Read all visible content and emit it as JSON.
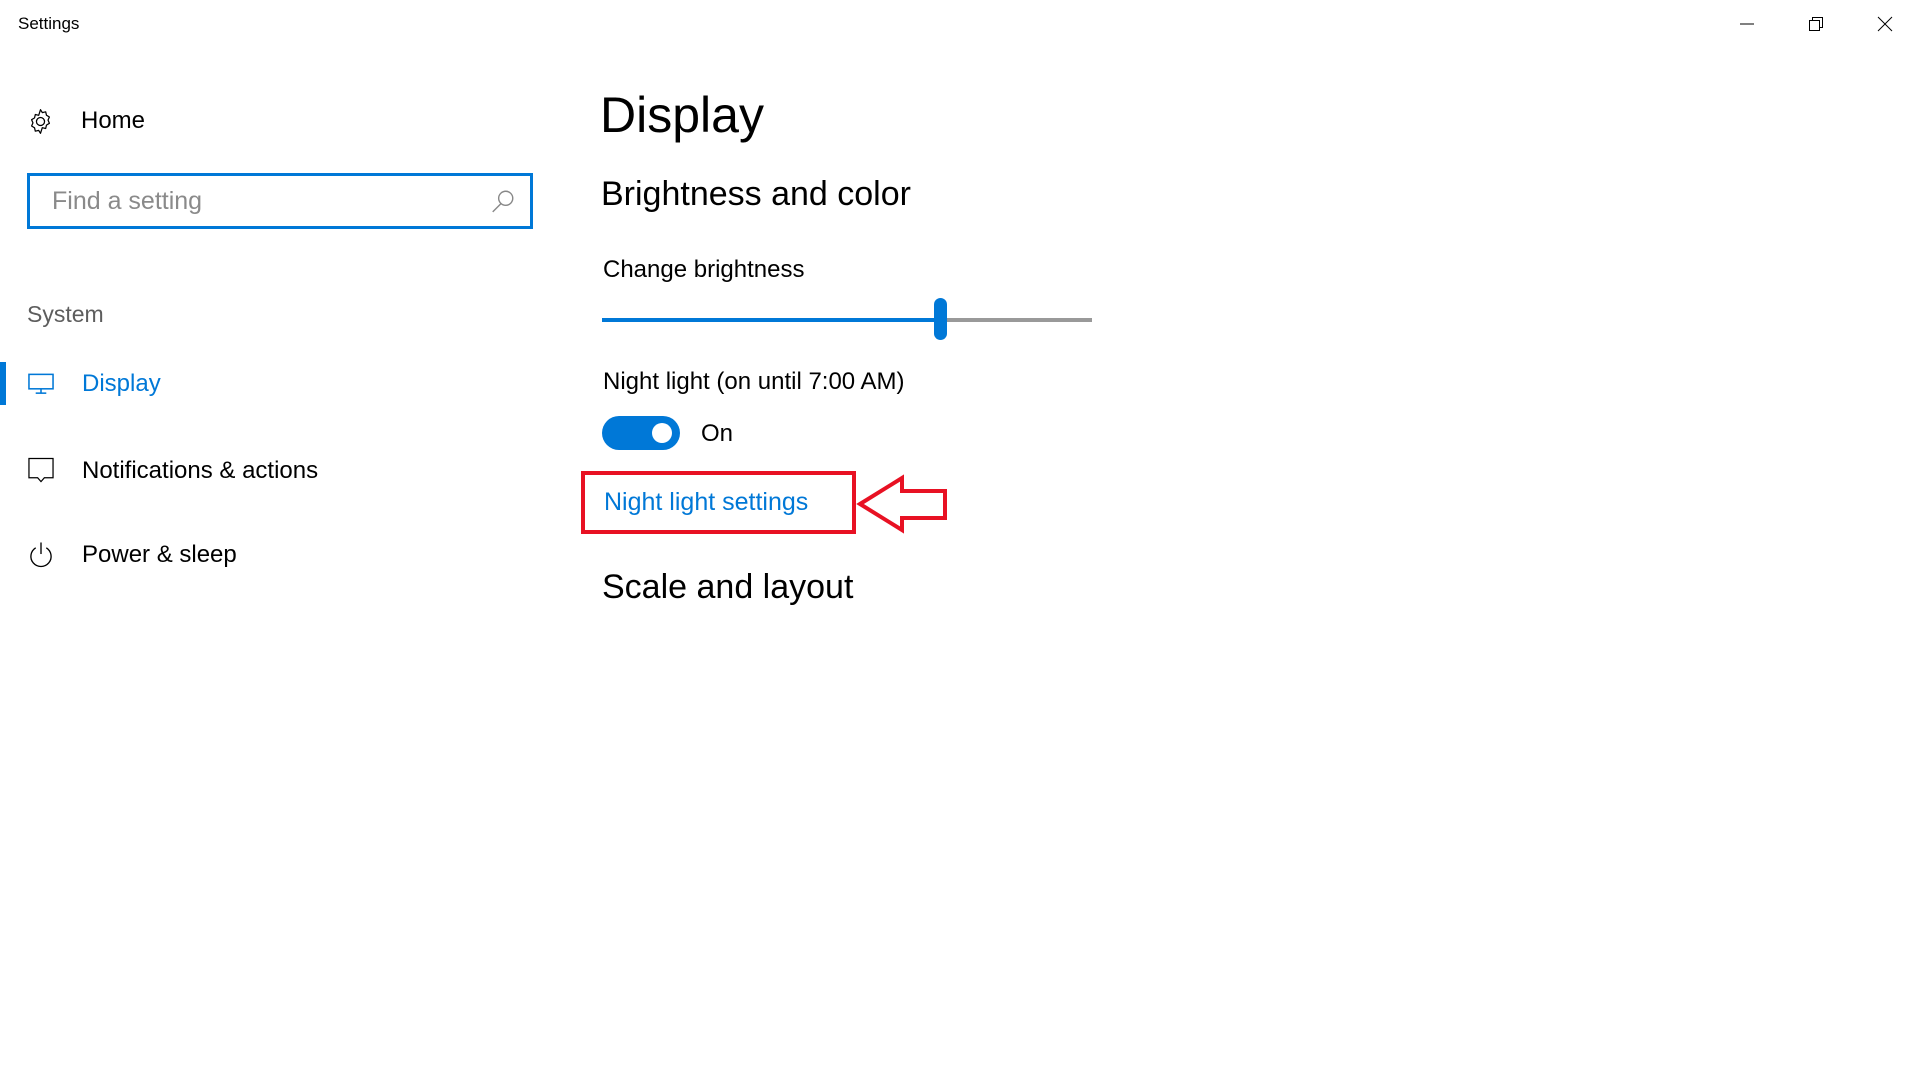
{
  "window": {
    "title": "Settings",
    "controls": {
      "minimize": "minimize-icon",
      "restore": "restore-icon",
      "close": "close-icon"
    }
  },
  "sidebar": {
    "home": {
      "label": "Home",
      "icon": "gear-icon"
    },
    "search": {
      "placeholder": "Find a setting",
      "value": "",
      "icon": "search-icon"
    },
    "section_label": "System",
    "items": [
      {
        "label": "Display",
        "icon": "monitor-icon",
        "active": true
      },
      {
        "label": "Notifications & actions",
        "icon": "notification-icon",
        "active": false
      },
      {
        "label": "Power & sleep",
        "icon": "power-icon",
        "active": false
      }
    ]
  },
  "main": {
    "title": "Display",
    "brightness_section": {
      "heading": "Brightness and color",
      "brightness_label": "Change brightness",
      "brightness_value_percent": 69,
      "night_light_label": "Night light (on until 7:00 AM)",
      "night_light_toggle": {
        "state": "On",
        "on": true
      },
      "night_light_settings_link": "Night light settings"
    },
    "scale_section": {
      "heading": "Scale and layout"
    }
  },
  "annotation": {
    "highlight_color": "#e81123",
    "target": "Night light settings",
    "arrow": "left-arrow-icon"
  },
  "colors": {
    "accent": "#0078d7",
    "slider_remaining": "#999999",
    "section_label": "#5d5d5d"
  }
}
